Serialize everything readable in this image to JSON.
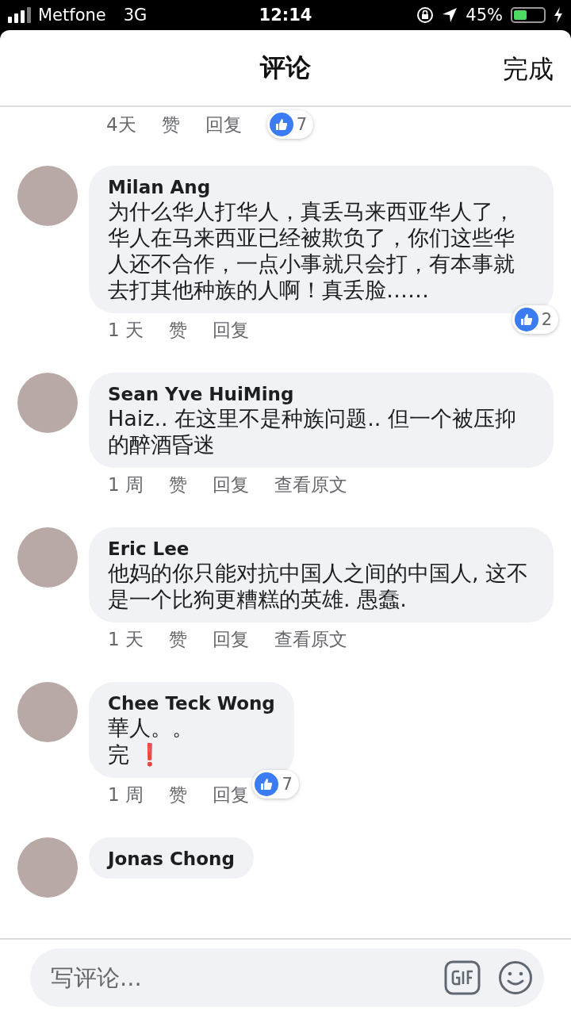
{
  "status_bar": {
    "carrier": "Metfone",
    "network": "3G",
    "time": "12:14",
    "battery_text": "45%",
    "battery": {
      "level": 0.45
    }
  },
  "header": {
    "title": "评论",
    "done": "完成"
  },
  "comments": [
    {
      "time": "4天",
      "actions": [
        "赞",
        "回复"
      ],
      "reactions": "7"
    },
    {
      "author": "Milan Ang",
      "lines": [
        "为什么华人打华人，真丢马来西亚华人了，华人在马来西亚已经被欺负了，你们这些华人还不合作，一点小事就只会打，有本事就去打其他种族的人啊！真丢脸……"
      ],
      "time": "1 天",
      "actions": [
        "赞",
        "回复"
      ],
      "reactions": "2"
    },
    {
      "author": "Sean Yve HuiMing",
      "lines": [
        "Haiz.. 在这里不是种族问题.. 但一个被压抑的醉酒昏迷"
      ],
      "time": "1 周",
      "actions": [
        "赞",
        "回复",
        "查看原文"
      ]
    },
    {
      "author": "Eric Lee",
      "lines": [
        "他妈的你只能对抗中国人之间的中国人, 这不是一个比狗更糟糕的英雄. 愚蠢."
      ],
      "time": "1 天",
      "actions": [
        "赞",
        "回复",
        "查看原文"
      ]
    },
    {
      "author": "Chee Teck Wong",
      "lines": [
        "華人。。",
        "完 ❗"
      ],
      "time": "1 周",
      "actions": [
        "赞",
        "回复"
      ],
      "reactions": "7"
    },
    {
      "author": "Jonas Chong"
    }
  ],
  "composer": {
    "placeholder": "写评论..."
  }
}
